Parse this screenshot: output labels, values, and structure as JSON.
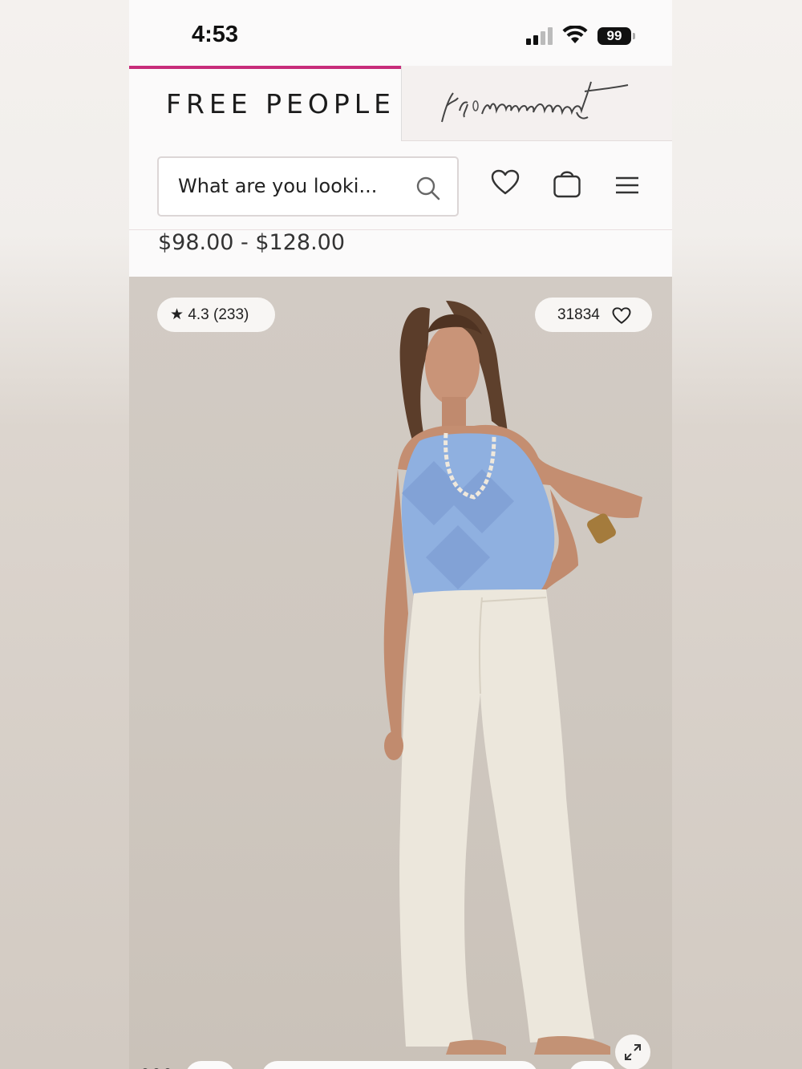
{
  "status_bar": {
    "time": "4:53",
    "battery": "99"
  },
  "brand_tabs": {
    "active_label": "FREE PEOPLE",
    "secondary_logo": "fp movement",
    "accent_color": "#c72c7a"
  },
  "header": {
    "search_placeholder": "What are you looki..."
  },
  "product": {
    "price_range": "$98.00 - $128.00",
    "rating": "4.3 (233)",
    "likes": "31834"
  }
}
